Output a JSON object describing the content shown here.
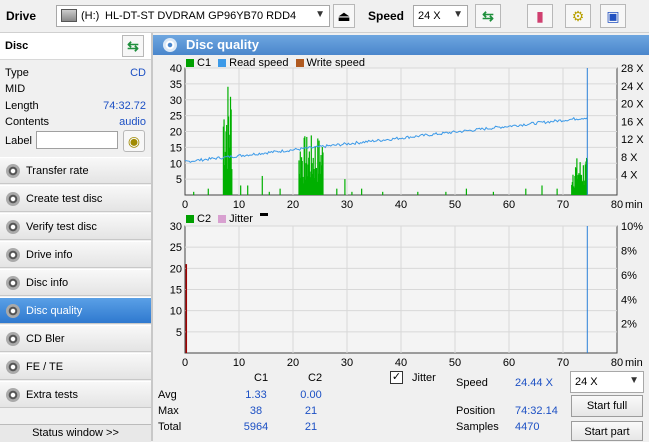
{
  "toolbar": {
    "drive_label": "Drive",
    "drive_letter": "(H:)",
    "drive_name": "HL-DT-ST DVDRAM GP96YB70 RDD4",
    "speed_label": "Speed",
    "speed_value": "24 X",
    "icons": [
      "drive-icon",
      "eject-icon",
      "swap-icon",
      "eraser-icon",
      "chip-icon",
      "save-icon"
    ]
  },
  "disc": {
    "header": "Disc",
    "type_label": "Type",
    "type_value": "CD",
    "mid_label": "MID",
    "mid_value": "",
    "length_label": "Length",
    "length_value": "74:32.72",
    "contents_label": "Contents",
    "contents_value": "audio",
    "label_label": "Label",
    "label_value": ""
  },
  "nav": {
    "items": [
      {
        "label": "Transfer rate"
      },
      {
        "label": "Create test disc"
      },
      {
        "label": "Verify test disc"
      },
      {
        "label": "Drive info"
      },
      {
        "label": "Disc info"
      },
      {
        "label": "Disc quality"
      },
      {
        "label": "CD Bler"
      },
      {
        "label": "FE / TE"
      },
      {
        "label": "Extra tests"
      }
    ],
    "active_index": 5,
    "status_window": "Status window >>"
  },
  "panel": {
    "title": "Disc quality"
  },
  "chart_data": [
    {
      "type": "bar",
      "legend": [
        {
          "name": "C1",
          "color": "#00a000"
        },
        {
          "name": "Read speed",
          "color": "#3c9ae8"
        },
        {
          "name": "Write speed",
          "color": "#b05a20"
        }
      ],
      "y_left_ticks": [
        "40",
        "35",
        "30",
        "25",
        "20",
        "15",
        "10",
        "5"
      ],
      "y_right_ticks": [
        "28 X",
        "24 X",
        "20 X",
        "16 X",
        "12 X",
        "8 X",
        "4 X"
      ],
      "x_ticks": [
        "0",
        "10",
        "20",
        "30",
        "40",
        "50",
        "60",
        "70",
        "80"
      ],
      "x_unit": "min",
      "xlim": [
        0,
        80
      ],
      "ylim": [
        0,
        40
      ],
      "read_speed": {
        "start_x": 0,
        "start_y": 10.5,
        "end_x": 74.5,
        "end_y": 24.4
      },
      "marker_x": 74.5,
      "c1_clusters": [
        {
          "x0": 7.0,
          "x1": 8.6,
          "peak": 38
        },
        {
          "x0": 21.0,
          "x1": 25.5,
          "peak": 19
        },
        {
          "x0": 71.5,
          "x1": 74.5,
          "peak": 12
        }
      ],
      "c1_isolated": [
        {
          "x": 1.5,
          "y": 1
        },
        {
          "x": 4.2,
          "y": 2
        },
        {
          "x": 10.2,
          "y": 3
        },
        {
          "x": 11.5,
          "y": 3
        },
        {
          "x": 14.2,
          "y": 6
        },
        {
          "x": 15.5,
          "y": 1
        },
        {
          "x": 17.5,
          "y": 2
        },
        {
          "x": 28.0,
          "y": 2
        },
        {
          "x": 29.5,
          "y": 5
        },
        {
          "x": 30.8,
          "y": 1
        },
        {
          "x": 32.6,
          "y": 2
        },
        {
          "x": 36.5,
          "y": 1
        },
        {
          "x": 43.0,
          "y": 1
        },
        {
          "x": 48.2,
          "y": 1
        },
        {
          "x": 52.0,
          "y": 2
        },
        {
          "x": 57.0,
          "y": 1
        },
        {
          "x": 63.0,
          "y": 2
        },
        {
          "x": 66.0,
          "y": 3
        },
        {
          "x": 68.8,
          "y": 2
        }
      ]
    },
    {
      "type": "bar",
      "legend": [
        {
          "name": "C2",
          "color": "#00a000"
        },
        {
          "name": "Jitter",
          "color": "#d8a0d0"
        }
      ],
      "y_left_ticks": [
        "30",
        "25",
        "20",
        "15",
        "10",
        "5"
      ],
      "y_right_ticks": [
        "10%",
        "8%",
        "6%",
        "4%",
        "2%"
      ],
      "x_ticks": [
        "0",
        "10",
        "20",
        "30",
        "40",
        "50",
        "60",
        "70",
        "80"
      ],
      "x_unit": "min",
      "xlim": [
        0,
        80
      ],
      "ylim": [
        0,
        30
      ],
      "c2_spike": {
        "x": 0.1,
        "y": 21
      },
      "marker_x": 74.5
    }
  ],
  "stats": {
    "col_c1": "C1",
    "col_c2": "C2",
    "avg_label": "Avg",
    "avg_c1": "1.33",
    "avg_c2": "0.00",
    "max_label": "Max",
    "max_c1": "38",
    "max_c2": "21",
    "total_label": "Total",
    "total_c1": "5964",
    "total_c2": "21",
    "jitter_label": "Jitter",
    "jitter_checked": true,
    "speed_label": "Speed",
    "speed_value": "24.44 X",
    "speed_select": "24 X",
    "position_label": "Position",
    "position_value": "74:32.14",
    "samples_label": "Samples",
    "samples_value": "4470",
    "start_full": "Start full",
    "start_part": "Start part"
  }
}
